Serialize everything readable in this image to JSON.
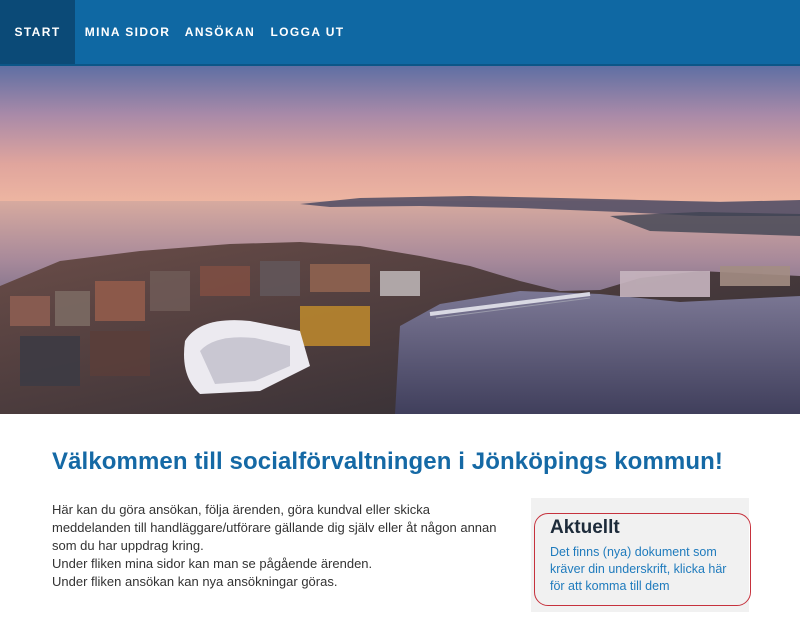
{
  "nav": {
    "items": [
      {
        "label": "START",
        "active": true
      },
      {
        "label": "MINA SIDOR",
        "active": false
      },
      {
        "label": "ANSÖKAN",
        "active": false
      },
      {
        "label": "LOGGA UT",
        "active": false
      }
    ]
  },
  "hero": {
    "description_icon": "city-waterfront-photo"
  },
  "main": {
    "title": "Välkommen till socialförvaltningen i Jönköpings kommun!",
    "intro_lines": [
      "Här kan du göra ansökan, följa ärenden, göra kundval eller skicka meddelanden till handläggare/utförare gällande dig själv eller åt någon annan som du har uppdrag kring.",
      "Under fliken mina sidor kan man se pågående ärenden.",
      "Under fliken ansökan kan nya ansökningar göras."
    ]
  },
  "aside": {
    "heading": "Aktuellt",
    "link_text": "Det finns (nya) dokument som kräver din underskrift, klicka här för att komma till dem"
  },
  "colors": {
    "nav_bg": "#0f68a3",
    "nav_active": "#0b4a77",
    "title": "#1569a5",
    "link": "#1f7bbd",
    "highlight_border": "#c6323d"
  }
}
